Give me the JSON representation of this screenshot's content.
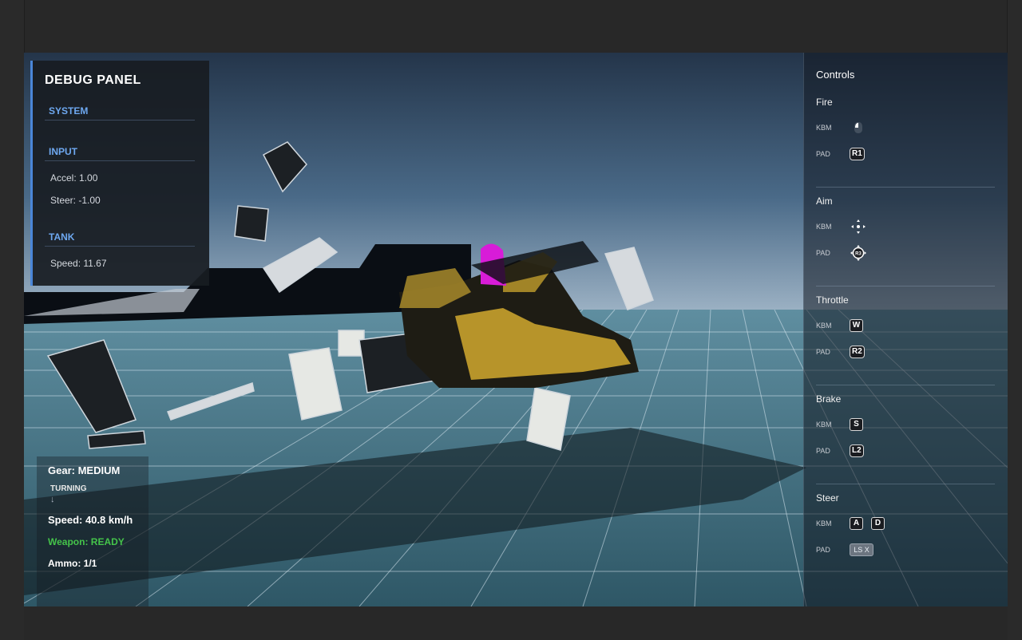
{
  "debug_panel": {
    "title": "DEBUG PANEL",
    "sections": {
      "system": {
        "header": "SYSTEM"
      },
      "input": {
        "header": "INPUT",
        "accel": "Accel: 1.00",
        "steer": "Steer: -1.00"
      },
      "tank": {
        "header": "TANK",
        "speed": "Speed: 11.67"
      }
    }
  },
  "hud": {
    "gear": "Gear: MEDIUM",
    "turning": "TURNING",
    "turn_arrow": "↓",
    "speed": "Speed: 40.8 km/h",
    "weapon": "Weapon: READY",
    "ammo": "Ammo: 1/1",
    "weapon_color": "#45c44a"
  },
  "controls": {
    "title": "Controls",
    "kbm_tag": "KBM",
    "pad_tag": "PAD",
    "groups": [
      {
        "label": "Fire",
        "kbm": {
          "icon": "mouse-left-click-icon"
        },
        "pad": {
          "key": "R1"
        }
      },
      {
        "label": "Aim",
        "kbm": {
          "icon": "mouse-move-icon"
        },
        "pad": {
          "key": "R3",
          "icon": "right-stick-press-icon"
        }
      },
      {
        "label": "Throttle",
        "kbm": {
          "key": "W"
        },
        "pad": {
          "key": "R2"
        }
      },
      {
        "label": "Brake",
        "kbm": {
          "key": "S"
        },
        "pad": {
          "key": "L2"
        }
      },
      {
        "label": "Steer",
        "kbm": {
          "keys": [
            "A",
            "D"
          ]
        },
        "pad": {
          "key": "LS X"
        }
      }
    ]
  },
  "colors": {
    "accent": "#4a86d8",
    "section_header": "#6ea8f0",
    "sky_top": "#2a3a4c",
    "ground": "#3f6f80",
    "marker": "#d81cd8",
    "gold": "#c8a22c"
  }
}
